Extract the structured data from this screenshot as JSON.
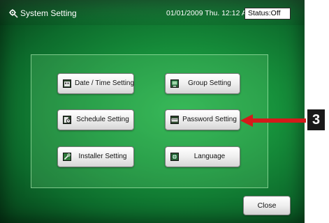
{
  "header": {
    "title": "System Setting",
    "datetime": "01/01/2009 Thu. 12:12 AM",
    "status": "Status:Off"
  },
  "menu": {
    "date_time": "Date / Time Setting",
    "group": "Group Setting",
    "schedule": "Schedule Setting",
    "password": "Password Setting",
    "installer": "Installer Setting",
    "language": "Language"
  },
  "footer": {
    "close": "Close"
  },
  "callout": {
    "step": "3",
    "arrow_color": "#d41a1a"
  },
  "colors": {
    "screen_green": "#17923c",
    "dark_green": "#063e18"
  },
  "icons": {
    "header": "gear-tools-icon",
    "date_time": "calendar-icon",
    "group": "group-screen-icon",
    "schedule": "schedule-icon",
    "password": "password-keyboard-icon",
    "installer": "installer-wrench-icon",
    "language": "language-globe-icon"
  }
}
